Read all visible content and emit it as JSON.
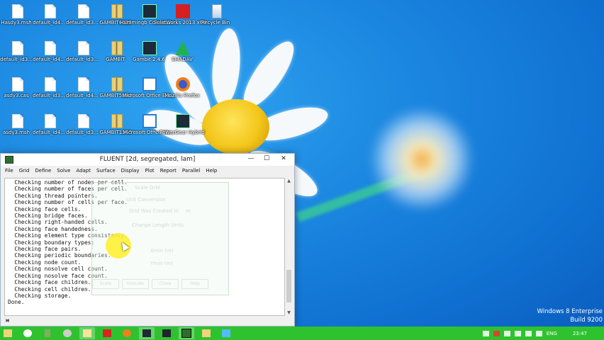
{
  "desktop": {
    "icons": [
      {
        "label": "Hasdy3.msh",
        "kind": "doc"
      },
      {
        "label": "default_id4...",
        "kind": "doc"
      },
      {
        "label": "default_id3...",
        "kind": "doc"
      },
      {
        "label": "GAMBIT6032",
        "kind": "zip"
      },
      {
        "label": "Hummingb Connectiv...",
        "kind": "app"
      },
      {
        "label": "SolidWorks 2013 x64...",
        "kind": "red"
      },
      {
        "label": "Recycle Bin",
        "kind": "bin"
      },
      {
        "label": "default_id3...",
        "kind": "doc"
      },
      {
        "label": "default_id4...",
        "kind": "doc"
      },
      {
        "label": "default_id3...",
        "kind": "doc"
      },
      {
        "label": "GAMBIT",
        "kind": "zip"
      },
      {
        "label": "Gambit 2.4.6",
        "kind": "app"
      },
      {
        "label": "SMADAV",
        "kind": "green"
      },
      {
        "label": "asdy3.cas",
        "kind": "doc"
      },
      {
        "label": "default_id3...",
        "kind": "doc"
      },
      {
        "label": "default_id4...",
        "kind": "doc"
      },
      {
        "label": "GAMBIT5184",
        "kind": "zip"
      },
      {
        "label": "Microsoft Office Exc...",
        "kind": "ms"
      },
      {
        "label": "Mozilla Firefox",
        "kind": "ff"
      },
      {
        "label": "asdy3.msh",
        "kind": "doc"
      },
      {
        "label": "default_id4...",
        "kind": "doc"
      },
      {
        "label": "default_id3...",
        "kind": "doc"
      },
      {
        "label": "GAMBIT1240",
        "kind": "zip"
      },
      {
        "label": "Microsoft Office Wo...",
        "kind": "ms"
      },
      {
        "label": "PowerGear Hybrid",
        "kind": "app"
      }
    ]
  },
  "window": {
    "title": "FLUENT  [2d, segregated, lam]",
    "controls": {
      "minimize": "—",
      "maximize": "☐",
      "close": "✕"
    },
    "menu": [
      "File",
      "Grid",
      "Define",
      "Solve",
      "Adapt",
      "Surface",
      "Display",
      "Plot",
      "Report",
      "Parallel",
      "Help"
    ],
    "console_lines": [
      "  Checking number of nodes per cell.",
      "  Checking number of faces per cell.",
      "  Checking thread pointers.",
      "  Checking number of cells per face.",
      "  Checking face cells.",
      "  Checking bridge faces.",
      "  Checking right-handed cells.",
      "  Checking face handedness.",
      "  Checking element type consistency.",
      "  Checking boundary types:",
      "  Checking face pairs.",
      "  Checking periodic boundaries.",
      "  Checking node count.",
      "  Checking nosolve cell count.",
      "  Checking nosolve face count.",
      "  Checking face children.",
      "  Checking cell children.",
      "  Checking storage.",
      "Done."
    ],
    "ghost_dialog": {
      "title": "Scale Grid",
      "section": "Unit Conversion",
      "grid_was_created_in": "Grid Was Created In",
      "unit": "m",
      "change_length_units": "Change Length Units",
      "xmin": "Xmin (m)",
      "ymin": "Ymin (m)",
      "buttons": [
        "Scale",
        "Unscale",
        "Close",
        "Help"
      ]
    }
  },
  "watermark": {
    "line1": "Windows 8 Enterprise",
    "line2": "Build 9200"
  },
  "taskbar": {
    "tray_lang": "ENG",
    "clock": "23:47"
  },
  "colors": {
    "taskbar": "#2ec32e",
    "desktop": "#1b86e0"
  }
}
